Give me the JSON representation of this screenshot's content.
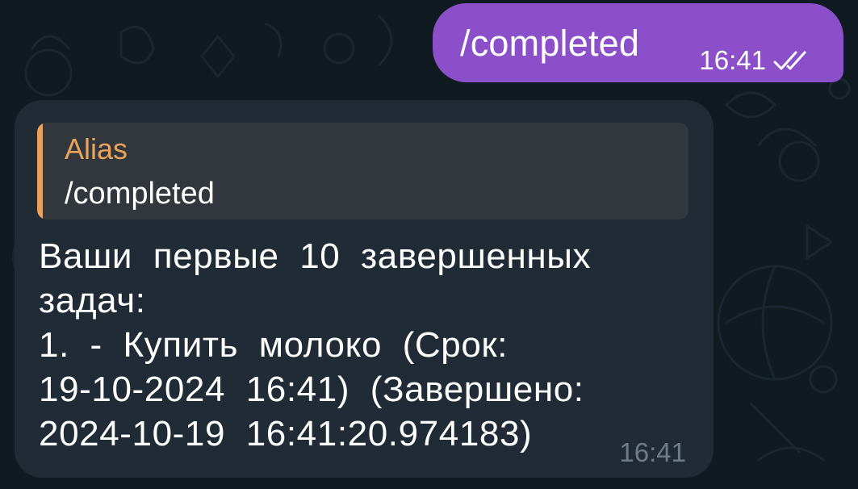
{
  "outgoing": {
    "text": "/completed",
    "time": "16:41",
    "status_icon": "double-check-icon"
  },
  "incoming": {
    "reply": {
      "name": "Alias",
      "text": "/completed"
    },
    "lines": [
      "Ваши  первые  10  завершенных",
      "задач:",
      "1.  -  Купить  молоко  (Срок:",
      "19-10-2024  16:41)  (Завершено:",
      "2024-10-19  16:41:20.974183)"
    ],
    "time": "16:41"
  },
  "colors": {
    "background": "#0f1a21",
    "outgoing_bubble": "#8b4fc9",
    "incoming_bubble": "#202b36",
    "reply_bar": "#e6a25b",
    "reply_name": "#eaa45c"
  }
}
